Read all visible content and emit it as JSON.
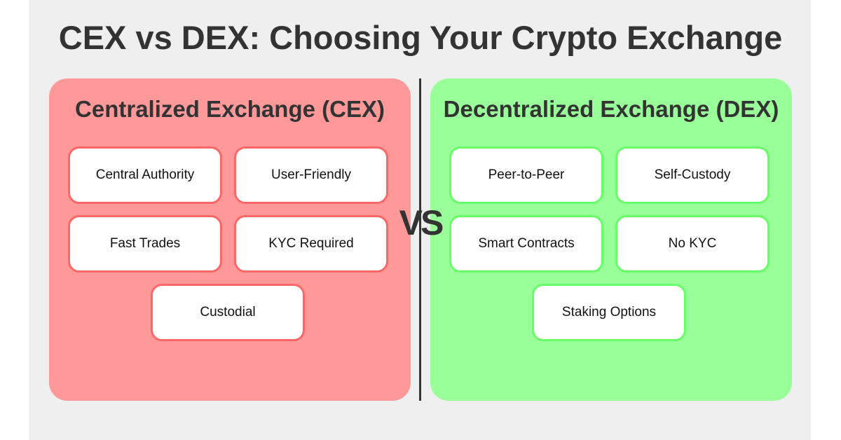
{
  "title": "CEX vs DEX: Choosing Your Crypto Exchange",
  "vs_label": "VS",
  "colors": {
    "background": "#efefef",
    "cex_panel": "#ff9999",
    "cex_border": "#ff6666",
    "dex_panel": "#99ff99",
    "dex_border": "#66ff66",
    "text_dark": "#333333"
  },
  "cex": {
    "title": "Centralized Exchange (CEX)",
    "features": [
      "Central Authority",
      "User-Friendly",
      "Fast Trades",
      "KYC Required",
      "Custodial"
    ]
  },
  "dex": {
    "title": "Decentralized Exchange (DEX)",
    "features": [
      "Peer-to-Peer",
      "Self-Custody",
      "Smart Contracts",
      "No KYC",
      "Staking Options"
    ]
  }
}
